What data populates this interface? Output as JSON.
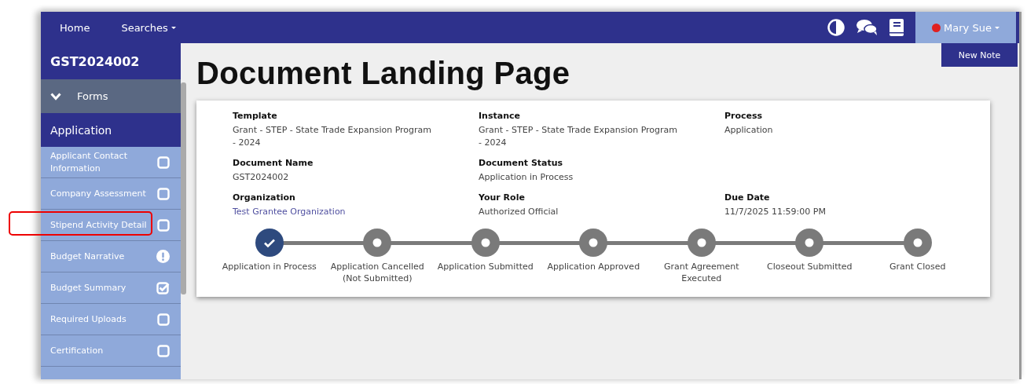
{
  "nav": {
    "links": [
      {
        "label": "Home",
        "dropdown": false
      },
      {
        "label": "Searches",
        "dropdown": true
      }
    ],
    "user": {
      "name": "Mary Sue"
    },
    "new_note": "New Note"
  },
  "sidebar": {
    "document_id": "GST2024002",
    "section": {
      "label": "Forms",
      "expanded": true
    },
    "group": "Application",
    "items": [
      {
        "label": "Applicant Contact Information",
        "kind": "checkbox",
        "checked": false,
        "highlighted": false
      },
      {
        "label": "Company Assessment",
        "kind": "checkbox",
        "checked": false,
        "highlighted": false
      },
      {
        "label": "Stipend Activity Detail",
        "kind": "checkbox",
        "checked": false,
        "highlighted": true
      },
      {
        "label": "Budget Narrative",
        "kind": "warning",
        "highlighted": false
      },
      {
        "label": "Budget Summary",
        "kind": "checkbox",
        "checked": true,
        "highlighted": false
      },
      {
        "label": "Required Uploads",
        "kind": "checkbox",
        "checked": false,
        "highlighted": false
      },
      {
        "label": "Certification",
        "kind": "checkbox",
        "checked": false,
        "highlighted": false
      }
    ]
  },
  "page_title": "Document Landing Page",
  "details": [
    [
      {
        "label": "Template",
        "value": "Grant - STEP - State Trade Expansion Program - 2024",
        "link": false
      },
      {
        "label": "Instance",
        "value": "Grant - STEP - State Trade Expansion Program - 2024",
        "link": false
      },
      {
        "label": "Process",
        "value": "Application",
        "link": false
      }
    ],
    [
      {
        "label": "Document Name",
        "value": "GST2024002",
        "link": false
      },
      {
        "label": "Document Status",
        "value": "Application in Process",
        "link": false
      }
    ],
    [
      {
        "label": "Organization",
        "value": "Test Grantee Organization",
        "link": true
      },
      {
        "label": "Your Role",
        "value": "Authorized Official",
        "link": false
      },
      {
        "label": "Due Date",
        "value": "11/7/2025 11:59:00 PM",
        "link": false
      }
    ]
  ],
  "steps": [
    {
      "label": "Application in Process",
      "completed": true
    },
    {
      "label": "Application Cancelled (Not Submitted)",
      "completed": false
    },
    {
      "label": "Application Submitted",
      "completed": false
    },
    {
      "label": "Application Approved",
      "completed": false
    },
    {
      "label": "Grant Agreement Executed",
      "completed": false
    },
    {
      "label": "Closeout Submitted",
      "completed": false
    },
    {
      "label": "Grant Closed",
      "completed": false
    }
  ]
}
